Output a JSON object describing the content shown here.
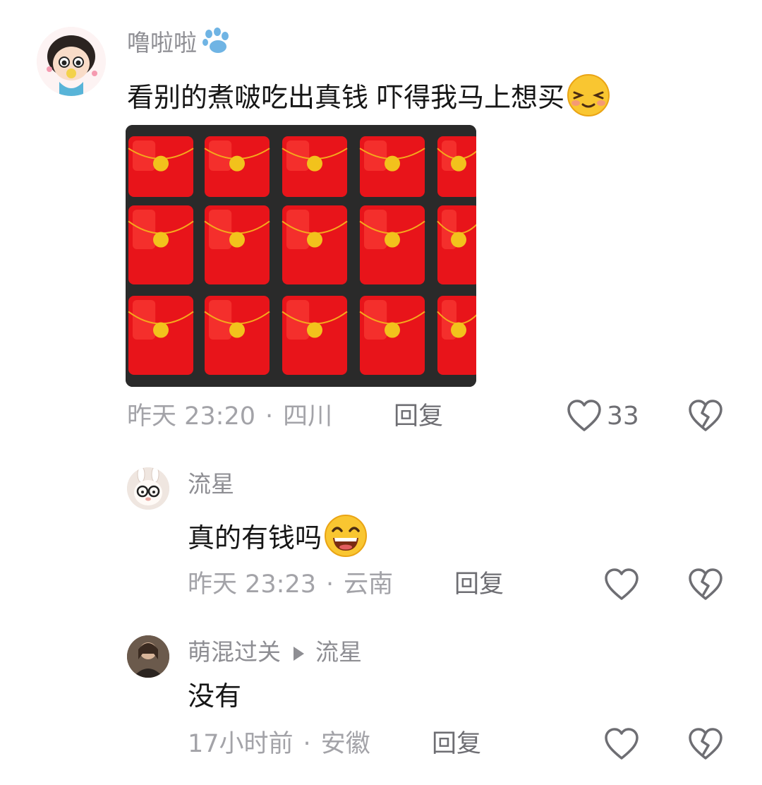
{
  "comments": [
    {
      "user": "噜啦啦",
      "user_badge_icon": "paw-icon",
      "text": "看别的煮啵吃出真钱 吓得我马上想买",
      "emoji": "shy-smile-emoji",
      "has_image": true,
      "image_description": "red-envelope-cakes",
      "time": "昨天 23:20",
      "location": "四川",
      "reply_label": "回复",
      "likes": "33"
    },
    {
      "user": "流星",
      "text": "真的有钱吗",
      "emoji": "grin-emoji",
      "time": "昨天 23:23",
      "location": "云南",
      "reply_label": "回复",
      "likes": ""
    },
    {
      "user": "萌混过关",
      "reply_to": "流星",
      "text": "没有",
      "time": "17小时前",
      "location": "安徽",
      "reply_label": "回复",
      "likes": ""
    }
  ],
  "colors": {
    "name": "#8e8e93",
    "text": "#161616",
    "meta": "#a3a3a8",
    "envelope_red": "#e8141a",
    "seal_gold": "#f2c21c",
    "tray": "#2a2a2a"
  },
  "separator": "·"
}
